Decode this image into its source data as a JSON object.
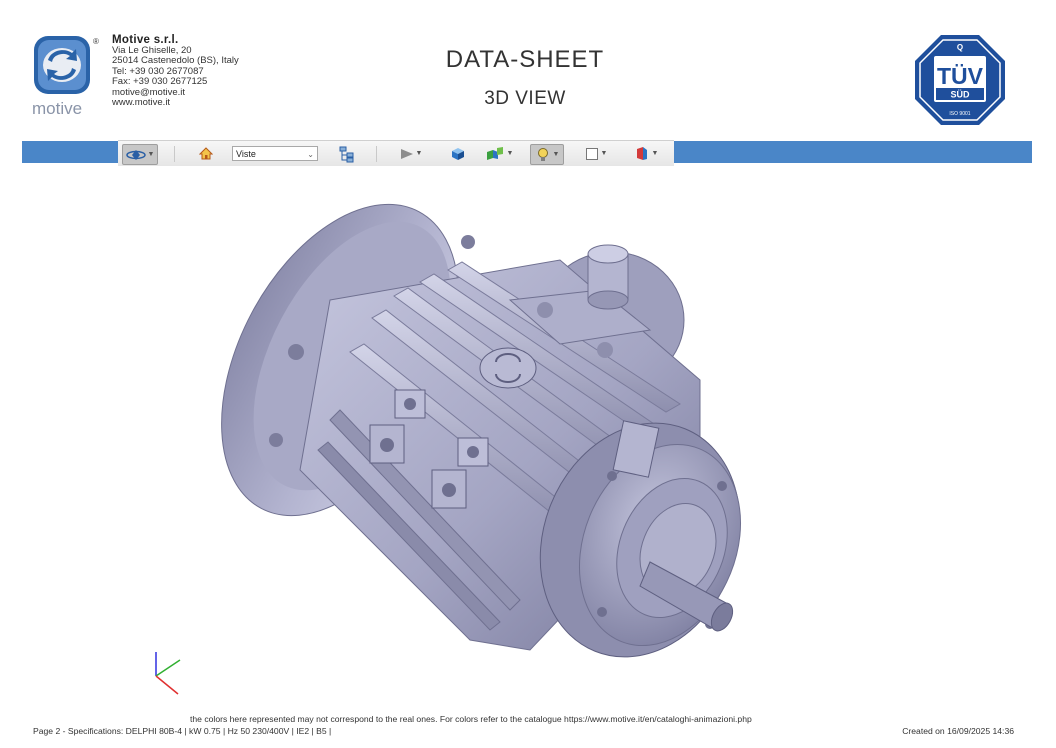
{
  "header": {
    "company": {
      "name": "Motive s.r.l.",
      "address1": "Via Le Ghiselle, 20",
      "address2": "25014 Castenedolo (BS), Italy",
      "tel": "Tel: +39 030 2677087",
      "fax": "Fax: +39 030 2677125",
      "email": "motive@motive.it",
      "web": "www.motive.it"
    },
    "logo": {
      "wordmark": "motive",
      "registered": "®",
      "icon": "motive-logo-icon"
    },
    "title": "DATA-SHEET",
    "subtitle": "3D VIEW",
    "certification": {
      "top": "Q",
      "main": "TÜV",
      "sub": "SÜD",
      "standard": "ISO 9001"
    }
  },
  "toolbar": {
    "view_select_value": "Viste",
    "icons": [
      "rotate-mode-icon",
      "home-icon",
      "model-tree-icon",
      "play-icon",
      "cube-icon",
      "parts-icon",
      "light-icon",
      "background-icon",
      "render-mode-icon"
    ]
  },
  "viewport": {
    "model": "electric-motor-3d-model",
    "model_color": "#a9aac8",
    "axis_colors": {
      "x": "#e03030",
      "y": "#30b030",
      "z": "#3030e0"
    }
  },
  "footer": {
    "note": "the colors here represented may not correspond to the real ones. For colors refer to the catalogue https://www.motive.it/en/cataloghi-animazioni.php",
    "page_spec": "Page 2 - Specifications: DELPHI 80B-4 | kW 0.75 | Hz 50 230/400V | IE2 | B5 |",
    "created": "Created on 16/09/2025 14:36"
  },
  "colors": {
    "toolbar_band": "#4a86c8",
    "logo_blue": "#2a63a8",
    "tuv_blue": "#1f4f9c"
  }
}
